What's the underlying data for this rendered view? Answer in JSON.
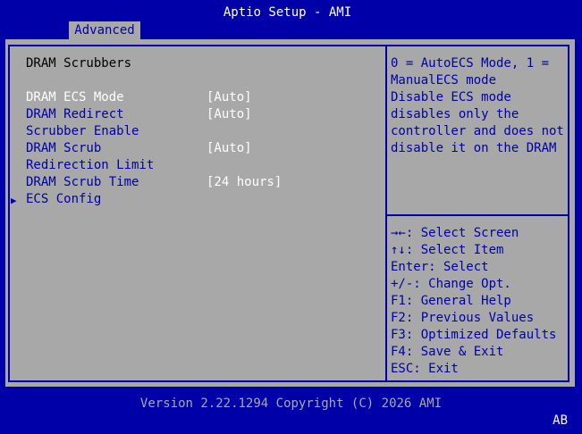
{
  "header": {
    "title": "Aptio Setup - AMI",
    "active_tab": "Advanced"
  },
  "main": {
    "section_title": "DRAM Scrubbers",
    "settings": [
      {
        "label": "DRAM ECS Mode",
        "value": "[Auto]"
      },
      {
        "label_line1": "DRAM Redirect",
        "label_line2": "Scrubber Enable",
        "value": "[Auto]"
      },
      {
        "label_line1": "DRAM Scrub",
        "label_line2": "Redirection Limit",
        "value": "[Auto]"
      },
      {
        "label": "DRAM Scrub Time",
        "value": "[24 hours]"
      }
    ],
    "submenu": {
      "arrow": "▶",
      "label": "ECS Config"
    }
  },
  "help": {
    "lines": [
      "0 = AutoECS Mode, 1 =",
      "ManualECS mode",
      "Disable ECS mode",
      "disables only the",
      "controller and does not",
      "disable it on the DRAM"
    ]
  },
  "keys": [
    "→←: Select Screen",
    "↑↓: Select Item",
    "Enter: Select",
    "+/-: Change Opt.",
    "F1: General Help",
    "F2: Previous Values",
    "F3: Optimized Defaults",
    "F4: Save & Exit",
    "ESC: Exit"
  ],
  "footer": {
    "version": "Version 2.22.1294 Copyright (C) 2026 AMI",
    "indicator": "AB"
  },
  "colors": {
    "background_blue": "#0000a8",
    "panel_gray": "#a8a8a8",
    "text_white": "#ffffff",
    "text_black": "#000000"
  }
}
